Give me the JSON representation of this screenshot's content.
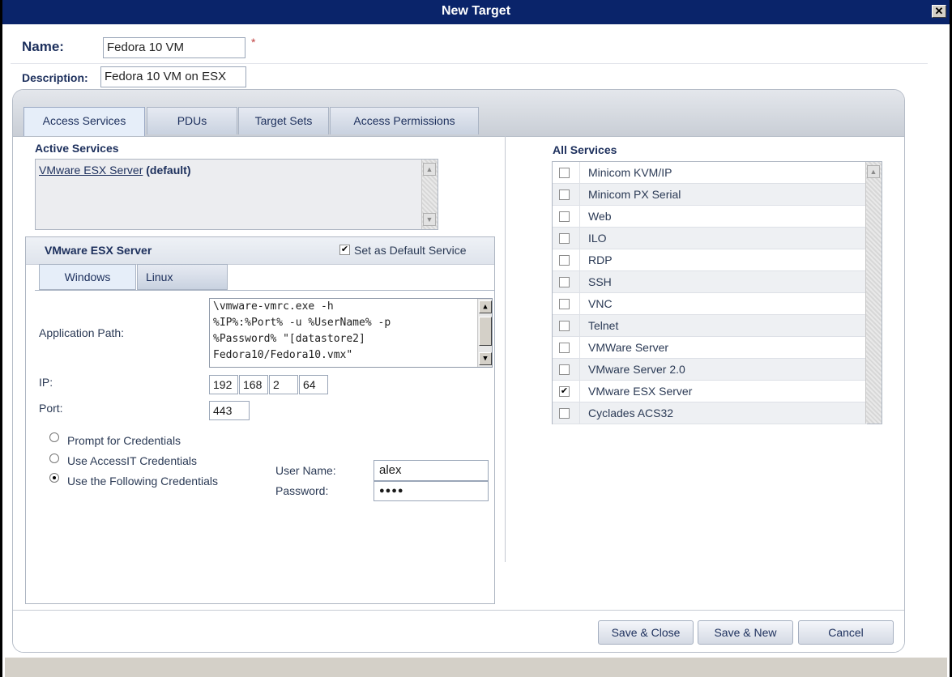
{
  "window": {
    "title": "New Target",
    "close_glyph": "✕"
  },
  "header": {
    "name_label": "Name:",
    "name_value": "Fedora 10 VM",
    "required_mark": "*",
    "description_label": "Description:",
    "description_value": "Fedora 10 VM on ESX"
  },
  "tabs": [
    "Access Services",
    "PDUs",
    "Target Sets",
    "Access Permissions"
  ],
  "active_services": {
    "title": "Active Services",
    "items": [
      {
        "name": "VMware ESX Server",
        "suffix": "(default)"
      }
    ]
  },
  "service_config": {
    "title": "VMware ESX Server",
    "default_label": "Set as Default Service",
    "default_checked": true,
    "os_tabs": [
      "Windows",
      "Linux"
    ],
    "app_path_label": "Application Path:",
    "app_path_lines": [
      "\\vmware-vmrc.exe -h",
      "%IP%:%Port% -u %UserName% -p",
      "%Password% \"[datastore2]",
      "Fedora10/Fedora10.vmx\""
    ],
    "ip_label": "IP:",
    "ip": [
      "192",
      "168",
      "2",
      "64"
    ],
    "port_label": "Port:",
    "port": "443",
    "credentials": {
      "options": [
        "Prompt for Credentials",
        "Use AccessIT Credentials",
        "Use the Following Credentials"
      ],
      "selected": "Use the Following Credentials",
      "username_label": "User Name:",
      "username": "alex",
      "password_label": "Password:",
      "password_mask": "●●●●"
    }
  },
  "all_services": {
    "title": "All Services",
    "items": [
      {
        "name": "Minicom KVM/IP",
        "checked": false
      },
      {
        "name": "Minicom PX Serial",
        "checked": false
      },
      {
        "name": "Web",
        "checked": false
      },
      {
        "name": "ILO",
        "checked": false
      },
      {
        "name": "RDP",
        "checked": false
      },
      {
        "name": "SSH",
        "checked": false
      },
      {
        "name": "VNC",
        "checked": false
      },
      {
        "name": "Telnet",
        "checked": false
      },
      {
        "name": "VMWare Server",
        "checked": false
      },
      {
        "name": "VMware Server 2.0",
        "checked": false
      },
      {
        "name": "VMware ESX Server",
        "checked": true
      },
      {
        "name": "Cyclades ACS32",
        "checked": false
      }
    ]
  },
  "buttons": {
    "save_close": "Save & Close",
    "save_new": "Save & New",
    "cancel": "Cancel"
  },
  "glyphs": {
    "check": "✔",
    "up": "▲",
    "down": "▼"
  }
}
